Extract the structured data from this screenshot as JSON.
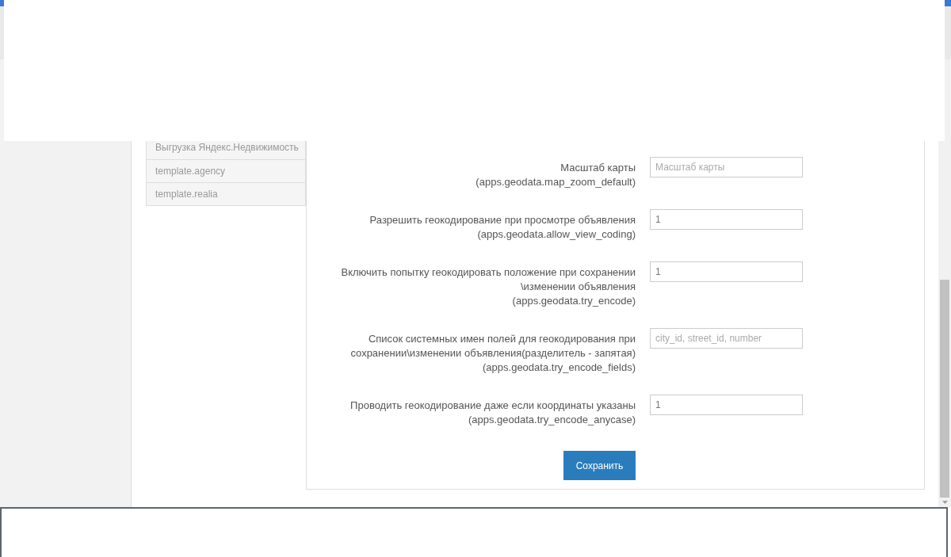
{
  "sidebar": {
    "items": [
      {
        "label": "Выгрузка Яндекс.Недвижимость"
      },
      {
        "label": "template.agency"
      },
      {
        "label": "template.realia"
      }
    ]
  },
  "form": {
    "fields": [
      {
        "label": "Масштаб карты",
        "key": "(apps.geodata.map_zoom_default)",
        "placeholder": "Масштаб карты"
      },
      {
        "label": "Разрешить геокодирование при просмотре объявления",
        "key": "(apps.geodata.allow_view_coding)",
        "value": "1"
      },
      {
        "label": "Включить попытку геокодировать положение при сохранении \\изменении объявления",
        "key": "(apps.geodata.try_encode)",
        "value": "1"
      },
      {
        "label": "Список системных имен полей для геокодирования при сохранении\\изменении объявления(разделитель - запятая)",
        "key": "(apps.geodata.try_encode_fields)",
        "placeholder": "city_id, street_id, number"
      },
      {
        "label": "Проводить геокодирование даже если координаты указаны",
        "key": "(apps.geodata.try_encode_anycase)",
        "value": "1"
      }
    ],
    "save_button": "Сохранить"
  }
}
